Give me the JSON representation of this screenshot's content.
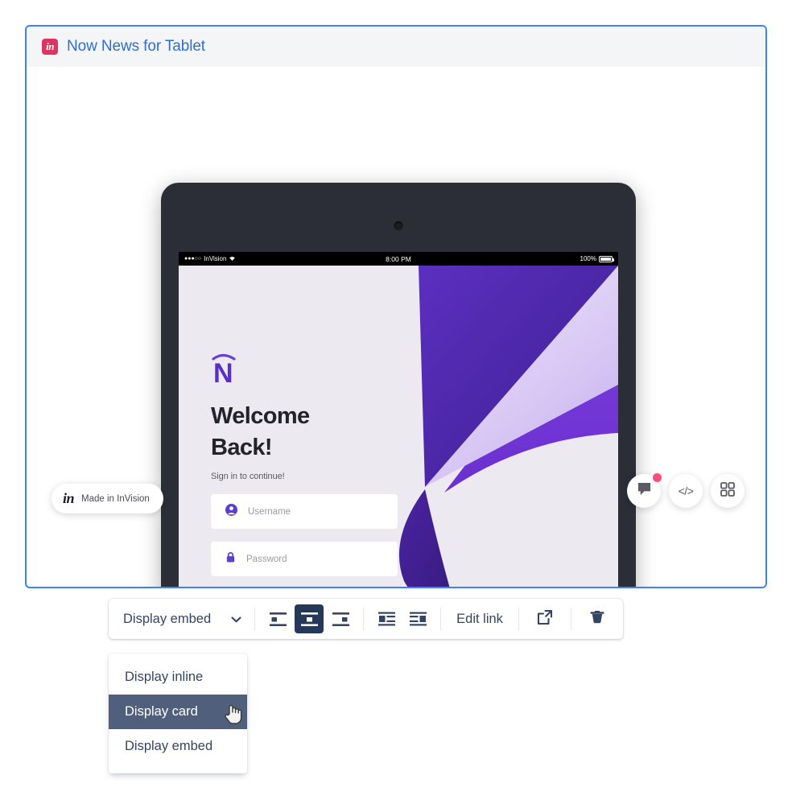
{
  "embed": {
    "logo_icon": "invision-logo-icon",
    "logo_text": "in",
    "title": "Now News for Tablet"
  },
  "prototype": {
    "status_bar": {
      "signal_dots": "●●●○○",
      "carrier": "InVision",
      "wifi_icon": "wifi-icon",
      "time": "8:00 PM",
      "battery_percent": "100%",
      "battery_icon": "battery-full-icon"
    },
    "app": {
      "logo_icon": "now-news-n-logo-icon",
      "heading_line1": "Welcome",
      "heading_line2": "Back!",
      "subheading": "Sign in to continue!",
      "fields": [
        {
          "name": "username",
          "icon": "person-icon",
          "placeholder": "Username",
          "value": ""
        },
        {
          "name": "password",
          "icon": "lock-icon",
          "placeholder": "Password",
          "value": ""
        }
      ],
      "submit_label": "",
      "accent_color": "#5b41c9",
      "accent_light": "#8257e6",
      "screen_bg": "#eceaf0"
    }
  },
  "overlays": {
    "made_in": {
      "logo_text": "in",
      "label": "Made in InVision"
    },
    "fabs": [
      {
        "name": "comment-fab",
        "icon": "comment-icon",
        "badge": true
      },
      {
        "name": "code-fab",
        "icon": "code-icon",
        "label": "</>",
        "badge": false
      },
      {
        "name": "grid-fab",
        "icon": "grid-icon",
        "badge": false
      }
    ],
    "badge_color": "#ff4d7e"
  },
  "toolbar": {
    "display_mode_label": "Display embed",
    "chevron_icon": "chevron-down-icon",
    "align_buttons": [
      {
        "name": "align-left-button",
        "icon": "align-left-icon",
        "active": false
      },
      {
        "name": "align-center-button",
        "icon": "align-center-icon",
        "active": true
      },
      {
        "name": "align-right-button",
        "icon": "align-right-icon",
        "active": false
      }
    ],
    "wrap_buttons": [
      {
        "name": "wrap-left-button",
        "icon": "wrap-left-icon",
        "active": false
      },
      {
        "name": "wrap-right-button",
        "icon": "wrap-right-icon",
        "active": false
      }
    ],
    "edit_link_label": "Edit link",
    "open_icon": "open-external-icon",
    "delete_icon": "trash-icon",
    "active_color": "#253858"
  },
  "dropdown": {
    "options": [
      {
        "label": "Display inline",
        "selected": false
      },
      {
        "label": "Display card",
        "selected": true
      },
      {
        "label": "Display embed",
        "selected": false
      }
    ],
    "highlight_color": "#50607c",
    "cursor_icon": "pointing-hand-cursor"
  }
}
